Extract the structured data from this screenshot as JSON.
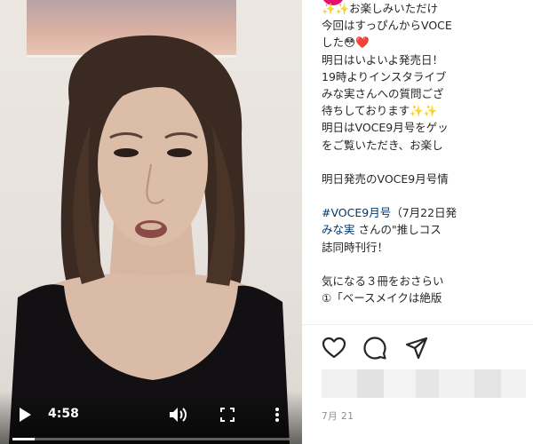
{
  "video": {
    "time": "4:58",
    "progress": 0.08
  },
  "icons": {
    "play": "play-icon",
    "volume": "volume-icon",
    "fullscreen": "fullscreen-icon",
    "more": "more-vertical-icon",
    "like": "heart-icon",
    "comment": "comment-icon",
    "share": "share-icon"
  },
  "caption": {
    "lines": [
      {
        "text": "✨✨お楽しみいただけ",
        "kind": "text"
      },
      {
        "text": "今回はすっぴんからVOCE",
        "kind": "text"
      },
      {
        "text": "した😳❤️",
        "kind": "text"
      },
      {
        "text": "明日はいよいよ発売日！",
        "kind": "text"
      },
      {
        "text": "19時よりインスタライブ",
        "kind": "text"
      },
      {
        "text": "みな実さんへの質問ござ",
        "kind": "text"
      },
      {
        "text": "待ちしております✨✨",
        "kind": "text"
      },
      {
        "text": "明日はVOCE9月号をゲッ",
        "kind": "text"
      },
      {
        "text": "をご覧いただき、お楽し",
        "kind": "text"
      },
      {
        "text": "",
        "kind": "text"
      },
      {
        "text": "明日発売のVOCE9月号情",
        "kind": "text"
      },
      {
        "text": "",
        "kind": "text"
      },
      {
        "text": "#VOCE9月号",
        "kind": "tag",
        "suffix": "（7月22日発"
      },
      {
        "text": "みな実",
        "kind": "tag",
        "suffix": " さんの\"推しコス"
      },
      {
        "text": "誌同時刊行！",
        "kind": "text"
      },
      {
        "text": "",
        "kind": "text"
      },
      {
        "text": "気になる３冊をおさらい",
        "kind": "text"
      },
      {
        "text": "①「ベースメイクは絶版",
        "kind": "text"
      }
    ]
  },
  "post": {
    "date": "7月 21"
  },
  "colors": {
    "link": "#00376b",
    "avatar_ring": "#e60f70"
  }
}
